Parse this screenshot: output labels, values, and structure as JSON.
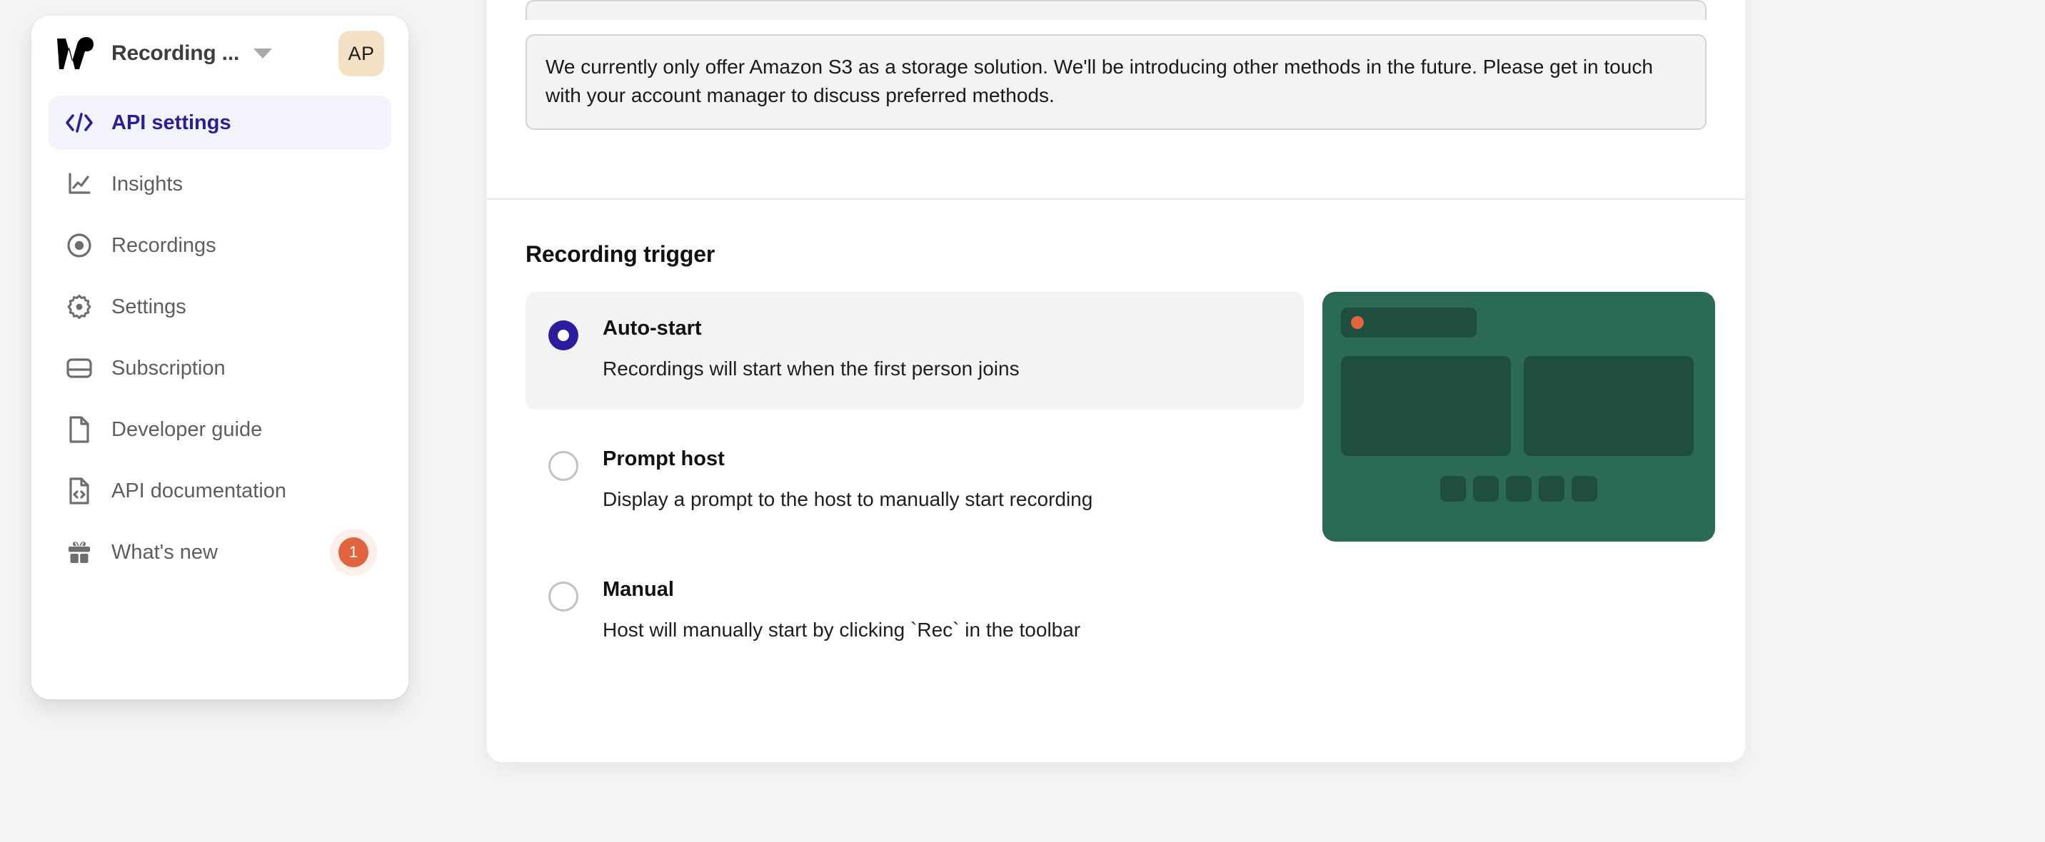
{
  "sidebar": {
    "brand": {
      "logo_icon": "w-logo-icon",
      "workspace_name": "Recording ...",
      "caret_icon": "chevron-down-icon",
      "avatar_initials": "AP"
    },
    "items": [
      {
        "label": "API settings",
        "icon": "code-brackets-icon",
        "active": true,
        "badge": null
      },
      {
        "label": "Insights",
        "icon": "line-chart-icon",
        "active": false,
        "badge": null
      },
      {
        "label": "Recordings",
        "icon": "record-dot-icon",
        "active": false,
        "badge": null
      },
      {
        "label": "Settings",
        "icon": "gear-icon",
        "active": false,
        "badge": null
      },
      {
        "label": "Subscription",
        "icon": "credit-card-icon",
        "active": false,
        "badge": null
      },
      {
        "label": "Developer guide",
        "icon": "document-icon",
        "active": false,
        "badge": null
      },
      {
        "label": "API documentation",
        "icon": "code-file-icon",
        "active": false,
        "badge": null
      },
      {
        "label": "What's new",
        "icon": "gift-icon",
        "active": false,
        "badge": "1"
      }
    ]
  },
  "main": {
    "callout": {
      "text": "We currently only offer Amazon S3 as a storage solution. We'll be introducing other methods in the future. Please get in touch with your account manager to discuss preferred methods."
    },
    "recording_trigger": {
      "title": "Recording trigger",
      "options": [
        {
          "title": "Auto-start",
          "description": "Recordings will start when the first person joins",
          "selected": true
        },
        {
          "title": "Prompt host",
          "description": "Display a prompt to the host to manually start recording",
          "selected": false
        },
        {
          "title": "Manual",
          "description": "Host will manually start by clicking `Rec` in the toolbar",
          "selected": false
        }
      ],
      "preview": {
        "name": "recording-layout-preview",
        "record_dot_color": "#e2643f",
        "background_color": "#2b6a55",
        "tile_color": "#1f4d3e",
        "toolbar_button_count": 5
      }
    }
  },
  "colors": {
    "page_background": "#f4f4f4",
    "accent_indigo": "#2b1e9e",
    "accent_orange": "#e2643f",
    "avatar_beige": "#f2e1c4",
    "active_nav_background": "#f3f3fb"
  }
}
